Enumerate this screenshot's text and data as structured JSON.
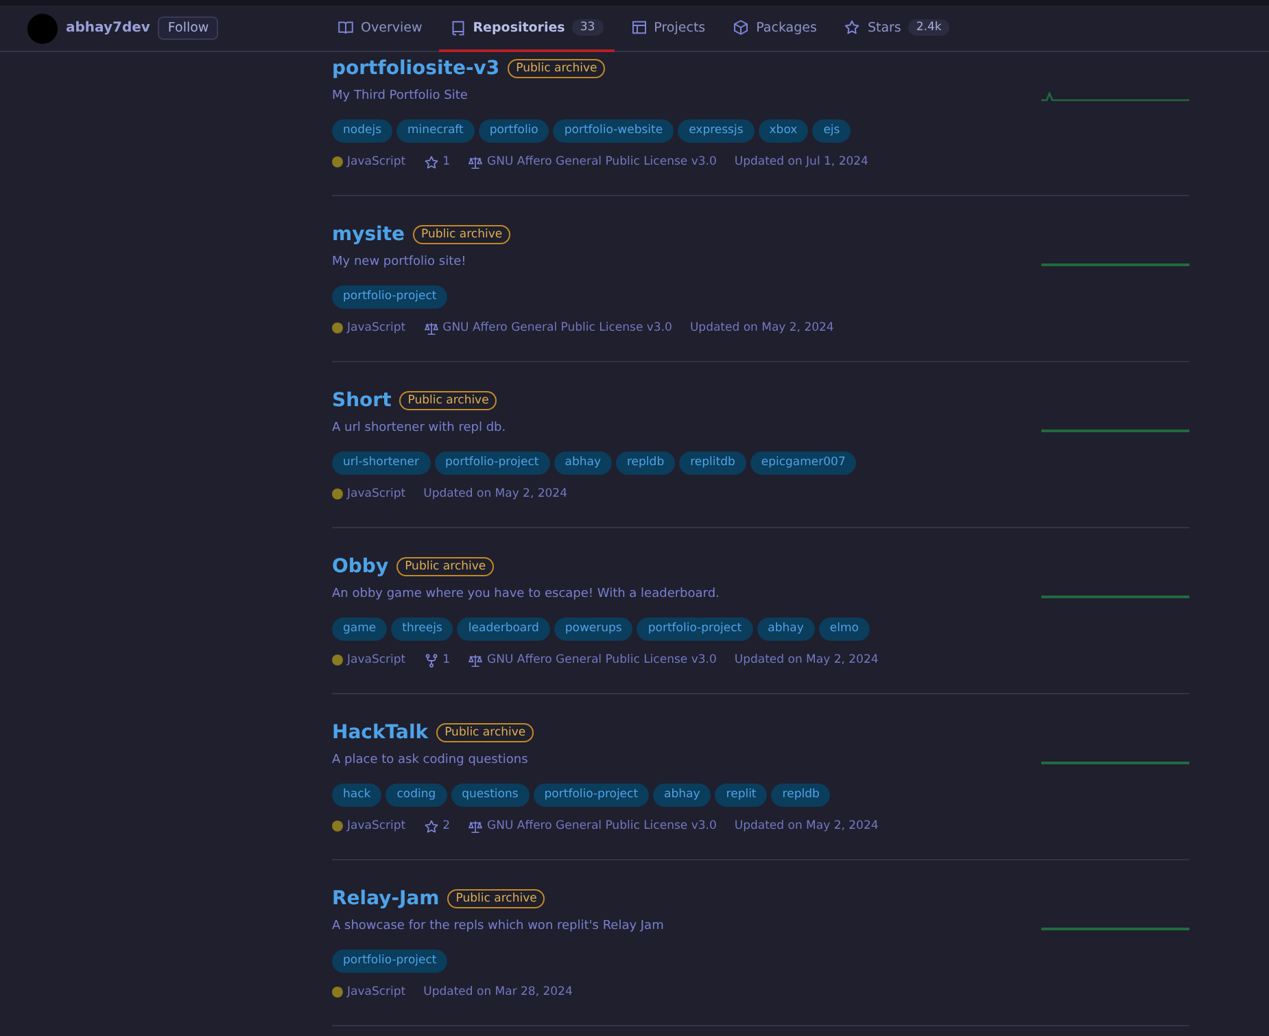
{
  "profile": {
    "username": "abhay7dev",
    "follow": "Follow"
  },
  "tabs": [
    {
      "label": "Overview",
      "selected": false
    },
    {
      "label": "Repositories",
      "count": "33",
      "selected": true
    },
    {
      "label": "Projects",
      "selected": false
    },
    {
      "label": "Packages",
      "selected": false
    },
    {
      "label": "Stars",
      "count": "2.4k",
      "selected": false
    }
  ],
  "repos": [
    {
      "name": "portfoliosite-v3",
      "badge": "Public archive",
      "description": "My Third Portfolio Site",
      "topics": [
        "nodejs",
        "minecraft",
        "portfolio",
        "portfolio-website",
        "expressjs",
        "xbox",
        "ejs"
      ],
      "language": "JavaScript",
      "meta": [
        {
          "kind": "stars",
          "text": "1"
        },
        {
          "kind": "license",
          "text": "GNU Affero General Public License v3.0"
        }
      ],
      "updated": "Updated on Jul 1, 2024",
      "activity_spike": true
    },
    {
      "name": "mysite",
      "badge": "Public archive",
      "description": "My new portfolio site!",
      "topics": [
        "portfolio-project"
      ],
      "language": "JavaScript",
      "meta": [
        {
          "kind": "license",
          "text": "GNU Affero General Public License v3.0"
        }
      ],
      "updated": "Updated on May 2, 2024",
      "activity_spike": false
    },
    {
      "name": "Short",
      "badge": "Public archive",
      "description": "A url shortener with repl db.",
      "topics": [
        "url-shortener",
        "portfolio-project",
        "abhay",
        "repldb",
        "replitdb",
        "epicgamer007"
      ],
      "language": "JavaScript",
      "updated": "Updated on May 2, 2024",
      "activity_spike": false
    },
    {
      "name": "Obby",
      "badge": "Public archive",
      "description": "An obby game where you have to escape! With a leaderboard.",
      "topics": [
        "game",
        "threejs",
        "leaderboard",
        "powerups",
        "portfolio-project",
        "abhay",
        "elmo"
      ],
      "language": "JavaScript",
      "meta": [
        {
          "kind": "forks",
          "text": "1"
        },
        {
          "kind": "license",
          "text": "GNU Affero General Public License v3.0"
        }
      ],
      "updated": "Updated on May 2, 2024",
      "activity_spike": false
    },
    {
      "name": "HackTalk",
      "badge": "Public archive",
      "description": "A place to ask coding questions",
      "topics": [
        "hack",
        "coding",
        "questions",
        "portfolio-project",
        "abhay",
        "replit",
        "repldb"
      ],
      "language": "JavaScript",
      "meta": [
        {
          "kind": "stars",
          "text": "2"
        },
        {
          "kind": "license",
          "text": "GNU Affero General Public License v3.0"
        }
      ],
      "updated": "Updated on May 2, 2024",
      "activity_spike": false
    },
    {
      "name": "Relay-Jam",
      "badge": "Public archive",
      "description": "A showcase for the repls which won replit's Relay Jam",
      "topics": [
        "portfolio-project"
      ],
      "language": "JavaScript",
      "updated": "Updated on Mar 28, 2024",
      "activity_spike": false
    }
  ]
}
